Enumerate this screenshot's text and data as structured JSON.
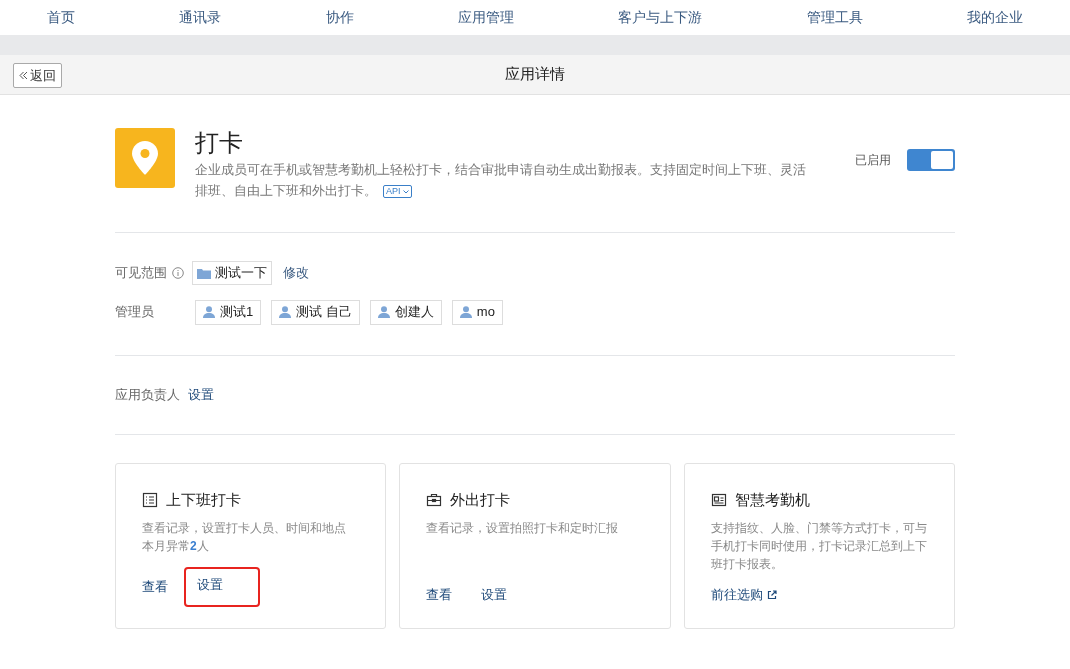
{
  "nav": [
    {
      "label": "首页"
    },
    {
      "label": "通讯录"
    },
    {
      "label": "协作"
    },
    {
      "label": "应用管理"
    },
    {
      "label": "客户与上下游"
    },
    {
      "label": "管理工具"
    },
    {
      "label": "我的企业"
    }
  ],
  "header": {
    "back": "返回",
    "title": "应用详情"
  },
  "app": {
    "name": "打卡",
    "description_lines": [
      "企业成员可在手机或智慧考勤机上轻松打卡，结合审批申请自动生成出勤报表。支持固定时间上下班、灵活",
      "排班、自由上下班和外出打卡。"
    ],
    "api_badge": "API",
    "status": "已启用",
    "on": true
  },
  "visibility": {
    "label": "可见范围",
    "items": [
      {
        "name": "测试一下"
      }
    ],
    "edit": "修改"
  },
  "admins": {
    "label": "管理员",
    "items": [
      {
        "name": "测试1"
      },
      {
        "name": "测试 自己"
      },
      {
        "name": "创建人"
      },
      {
        "name": "mo"
      }
    ]
  },
  "owner": {
    "label": "应用负责人",
    "action": "设置"
  },
  "cards": [
    {
      "kind": "list",
      "title": "上下班打卡",
      "lines": [
        "查看记录，设置打卡人员、时间和地点",
        "本月异常**2**人"
      ],
      "actions": [
        {
          "label": "查看",
          "kind": "link",
          "highlighted": false
        },
        {
          "label": "设置",
          "kind": "link",
          "highlighted": true
        }
      ]
    },
    {
      "kind": "briefcase",
      "title": "外出打卡",
      "lines": [
        "查看记录，设置拍照打卡和定时汇报"
      ],
      "actions": [
        {
          "label": "查看",
          "kind": "link",
          "highlighted": false
        },
        {
          "label": "设置",
          "kind": "link",
          "highlighted": false
        }
      ]
    },
    {
      "kind": "device",
      "title": "智慧考勤机",
      "lines": [
        "支持指纹、人脸、门禁等方式打卡，可与手机打卡同时使用，打卡记录汇总到上下班打卡报表。"
      ],
      "actions": [
        {
          "label": "前往选购",
          "kind": "external",
          "highlighted": false
        }
      ]
    }
  ]
}
